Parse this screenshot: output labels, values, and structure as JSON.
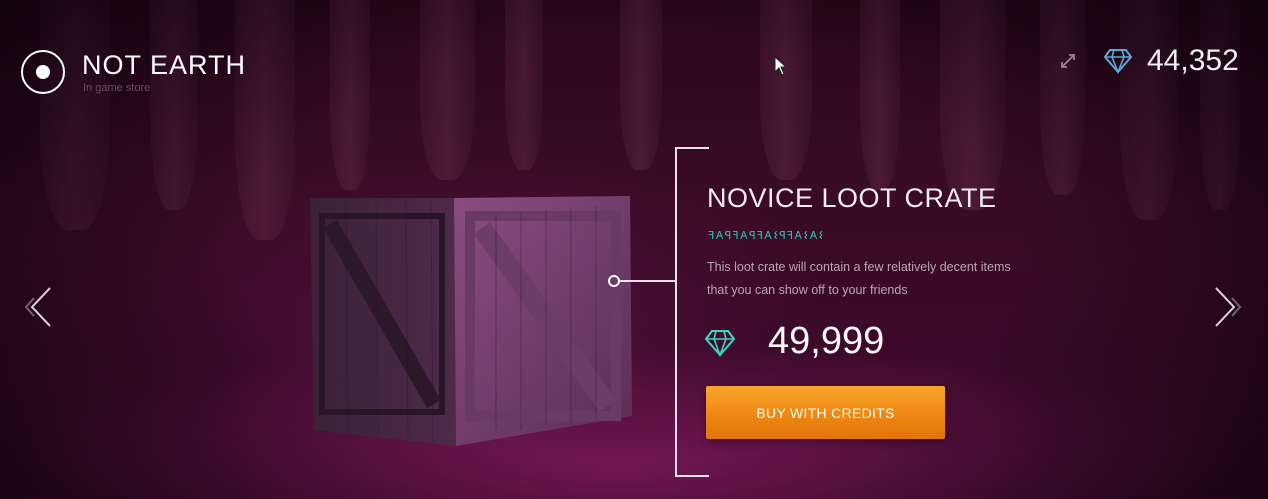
{
  "header": {
    "brand_title": "NOT EARTH",
    "brand_subtitle": "In game store",
    "credits_balance": "44,352",
    "icons": {
      "expand": "expand-icon",
      "gem": "gem-icon",
      "logo": "logo-icon"
    }
  },
  "product": {
    "name": "NOVICE LOOT CRATE",
    "alien_glyphs": "ꟻ𐌀ꟼꟻ𐌀ꟼꟻ𐌀𐌔ꟼꟻ𐌀𐌔𐌀𐌔",
    "description": "This loot crate will contain a few relatively decent items that you can show off to your friends",
    "price": "49,999",
    "buy_label": "BUY WITH CREDITS"
  },
  "navigation": {
    "prev_icon": "chevron-left-icon",
    "next_icon": "chevron-right-icon"
  },
  "colors": {
    "accent_orange": "#f08a14",
    "glyph_teal": "#2fc3b0",
    "gem_blue": "#5aa9d6",
    "gem_teal": "#3fd6c4",
    "background": "#3a0b25"
  }
}
